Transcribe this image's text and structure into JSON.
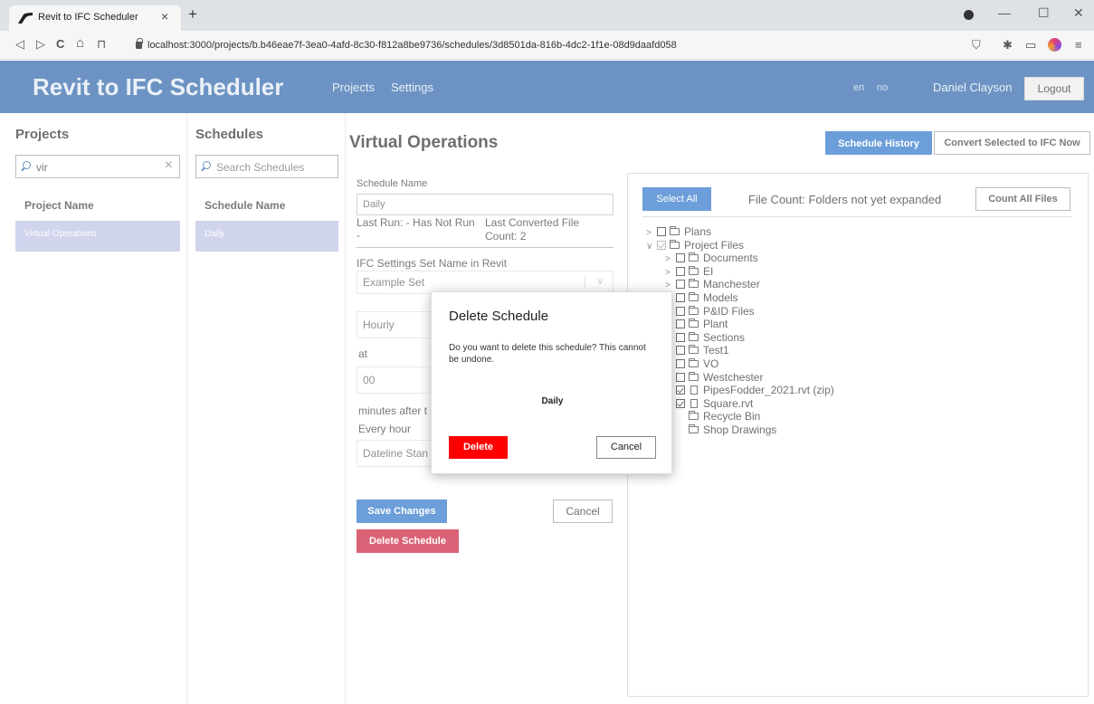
{
  "browser": {
    "tab_title": "Revit to IFC Scheduler",
    "tab_close": "×",
    "new_tab": "+",
    "url": "localhost:3000/projects/b.b46eae7f-3ea0-4afd-8c30-f812a8be9736/schedules/3d8501da-816b-4dc2-1f1e-08d9daafd058",
    "nav": {
      "back": "◁",
      "forward": "▷",
      "reload": "C",
      "home": "⌂",
      "bookmark": "⊓"
    },
    "window": {
      "minimize": "—",
      "maximize": "☐",
      "close": "✕"
    },
    "ext": {
      "shield": "⛉",
      "puzzle": "✱",
      "wallet": "▭",
      "menu": "≡"
    }
  },
  "app": {
    "title": "Revit to IFC Scheduler",
    "nav": {
      "projects": "Projects",
      "settings": "Settings"
    },
    "lang": {
      "en": "en",
      "no": "no"
    },
    "user": "Daniel Clayson",
    "logout": "Logout",
    "brand_color": "#1e5aa4"
  },
  "projects": {
    "title": "Projects",
    "search_value": "vir",
    "clear": "×",
    "header": "Project Name",
    "items": [
      "Virtual Operations"
    ]
  },
  "schedules": {
    "title": "Schedules",
    "search_placeholder": "Search Schedules",
    "header": "Schedule Name",
    "items": [
      "Daily"
    ]
  },
  "main": {
    "title": "Virtual Operations",
    "schedule_history": "Schedule History",
    "convert_now": "Convert Selected to IFC Now",
    "schedule_name_label": "Schedule Name",
    "schedule_name_value": "Daily",
    "last_run_label": "Last Run: - Has Not Run",
    "last_run_dash": "-",
    "last_converted_label": "Last Converted File",
    "last_converted_count": "Count: 2",
    "ifc_label": "IFC Settings Set Name in Revit",
    "ifc_value": "Example Set",
    "ifc_chevron": "∨",
    "frequency": "Hourly",
    "at_label": "at",
    "minutes_value": "00",
    "minutes_after": "minutes after t",
    "every_hour": "Every hour",
    "timezone": "Dateline Stan",
    "save": "Save Changes",
    "cancel": "Cancel",
    "delete_schedule": "Delete Schedule"
  },
  "files": {
    "select_all": "Select All",
    "file_count": "File Count: Folders not yet expanded",
    "count_all": "Count All Files",
    "tree": [
      {
        "label": "Plans",
        "depth": 0,
        "chevron": ">",
        "checked": false,
        "type": "folder"
      },
      {
        "label": "Project Files",
        "depth": 0,
        "chevron": "∨",
        "checked": true,
        "type": "folder-open"
      },
      {
        "label": "Documents",
        "depth": 1,
        "chevron": ">",
        "checked": false,
        "type": "folder"
      },
      {
        "label": "EI",
        "depth": 1,
        "chevron": ">",
        "checked": false,
        "type": "folder"
      },
      {
        "label": "Manchester",
        "depth": 1,
        "chevron": ">",
        "checked": false,
        "type": "folder"
      },
      {
        "label": "Models",
        "depth": 1,
        "chevron": "",
        "checked": false,
        "type": "folder"
      },
      {
        "label": "P&ID Files",
        "depth": 1,
        "chevron": "",
        "checked": false,
        "type": "folder"
      },
      {
        "label": "Plant",
        "depth": 1,
        "chevron": "",
        "checked": false,
        "type": "folder"
      },
      {
        "label": "Sections",
        "depth": 1,
        "chevron": "",
        "checked": false,
        "type": "folder"
      },
      {
        "label": "Test1",
        "depth": 1,
        "chevron": "",
        "checked": false,
        "type": "folder"
      },
      {
        "label": "VO",
        "depth": 1,
        "chevron": "",
        "checked": false,
        "type": "folder"
      },
      {
        "label": "Westchester",
        "depth": 1,
        "chevron": "",
        "checked": false,
        "type": "folder"
      },
      {
        "label": "PipesFodder_2021.rvt (zip)",
        "depth": 1,
        "chevron": "",
        "checked": true,
        "type": "file"
      },
      {
        "label": "Square.rvt",
        "depth": 1,
        "chevron": "",
        "checked": true,
        "type": "file"
      },
      {
        "label": "Recycle Bin",
        "depth": 1,
        "chevron": "",
        "checked": null,
        "type": "folder"
      },
      {
        "label": "Shop Drawings",
        "depth": 1,
        "chevron": "",
        "checked": null,
        "type": "folder"
      }
    ]
  },
  "modal": {
    "title": "Delete Schedule",
    "message": "Do you want to delete this schedule? This cannot be undone.",
    "schedule_name": "Daily",
    "delete": "Delete",
    "cancel": "Cancel",
    "delete_color": "#ff0000"
  }
}
